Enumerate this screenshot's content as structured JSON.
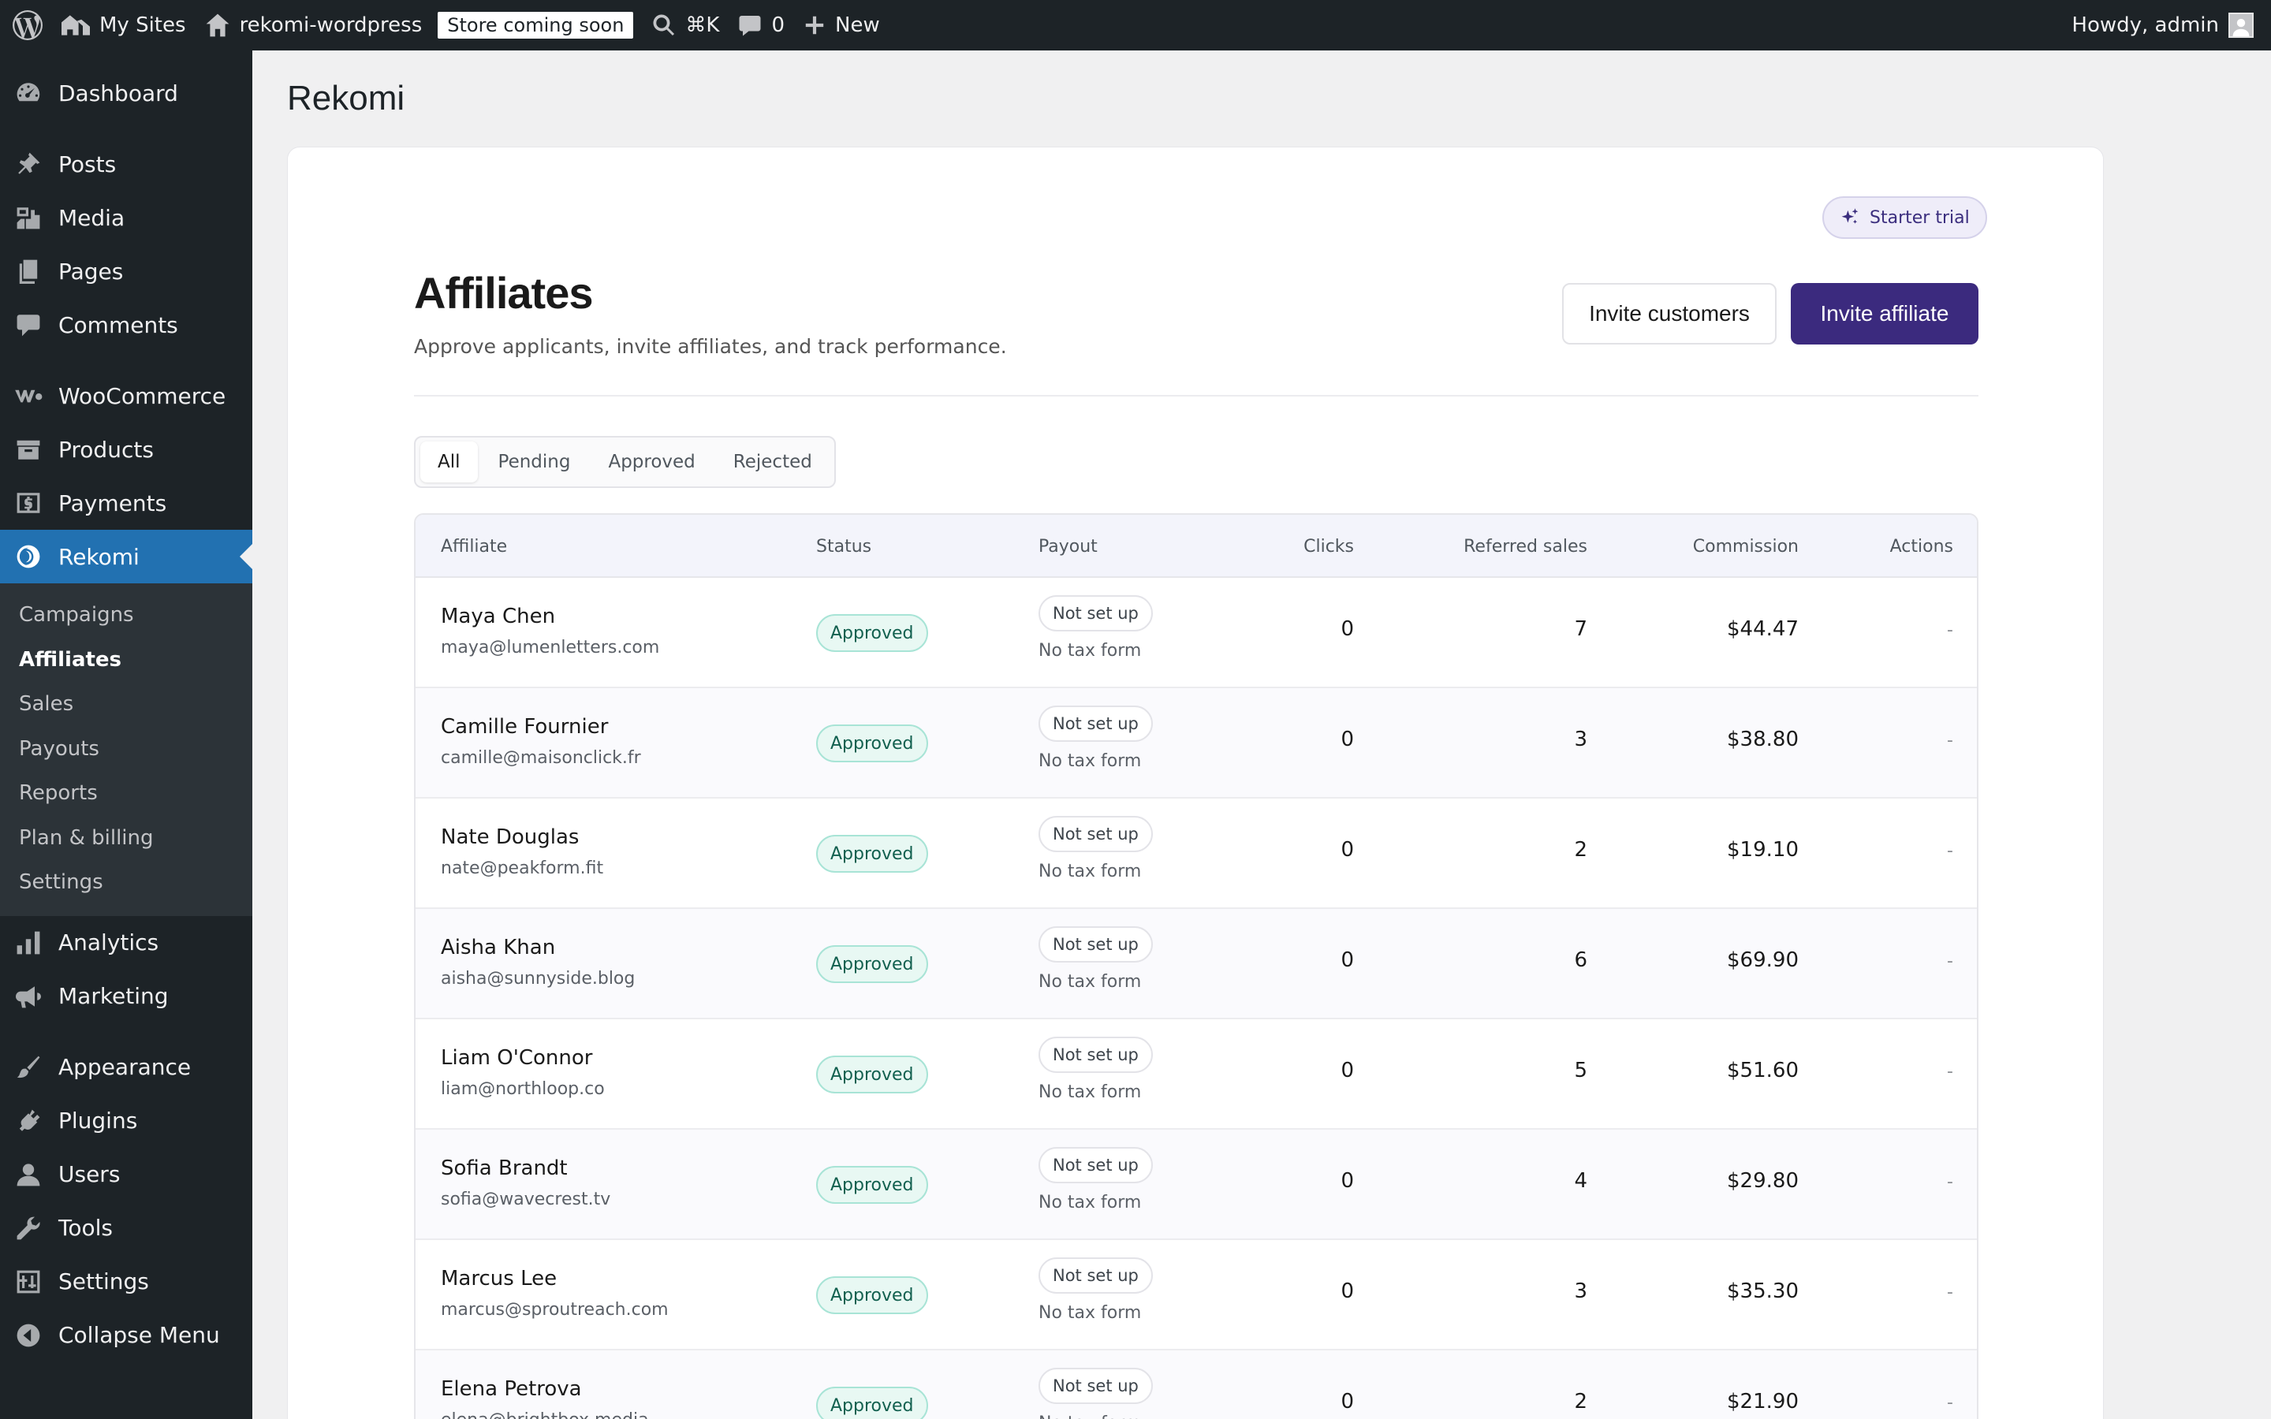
{
  "adminbar": {
    "my_sites": "My Sites",
    "site_name": "rekomi-wordpress",
    "store_badge": "Store coming soon",
    "search_shortcut": "⌘K",
    "comments_count": "0",
    "new_label": "New",
    "howdy": "Howdy, admin"
  },
  "sidebar": {
    "items": [
      {
        "label": "Dashboard",
        "icon": "dashboard-icon"
      },
      {
        "label": "Posts",
        "icon": "pin-icon"
      },
      {
        "label": "Media",
        "icon": "media-icon"
      },
      {
        "label": "Pages",
        "icon": "pages-icon"
      },
      {
        "label": "Comments",
        "icon": "comments-icon"
      },
      {
        "label": "WooCommerce",
        "icon": "woocommerce-icon"
      },
      {
        "label": "Products",
        "icon": "archive-icon"
      },
      {
        "label": "Payments",
        "icon": "dollar-icon"
      },
      {
        "label": "Rekomi",
        "icon": "rekomi-icon"
      },
      {
        "label": "Analytics",
        "icon": "bar-chart-icon"
      },
      {
        "label": "Marketing",
        "icon": "megaphone-icon"
      },
      {
        "label": "Appearance",
        "icon": "brush-icon"
      },
      {
        "label": "Plugins",
        "icon": "plug-icon"
      },
      {
        "label": "Users",
        "icon": "user-icon"
      },
      {
        "label": "Tools",
        "icon": "wrench-icon"
      },
      {
        "label": "Settings",
        "icon": "settings-icon"
      },
      {
        "label": "Collapse Menu",
        "icon": "collapse-icon"
      }
    ],
    "submenu": [
      "Campaigns",
      "Affiliates",
      "Sales",
      "Payouts",
      "Reports",
      "Plan & billing",
      "Settings"
    ]
  },
  "page": {
    "heading": "Rekomi",
    "trial_label": "Starter trial",
    "title": "Affiliates",
    "subtitle": "Approve applicants, invite affiliates, and track performance.",
    "invite_customers": "Invite customers",
    "invite_affiliate": "Invite affiliate"
  },
  "filters": [
    "All",
    "Pending",
    "Approved",
    "Rejected"
  ],
  "table": {
    "headers": [
      "Affiliate",
      "Status",
      "Payout",
      "Clicks",
      "Referred sales",
      "Commission",
      "Actions"
    ],
    "rows": [
      {
        "name": "Maya Chen",
        "email": "maya@lumenletters.com",
        "status": "Approved",
        "payout": "Not set up",
        "tax": "No tax form",
        "clicks": "0",
        "sales": "7",
        "commission": "$44.47",
        "actions": "-"
      },
      {
        "name": "Camille Fournier",
        "email": "camille@maisonclick.fr",
        "status": "Approved",
        "payout": "Not set up",
        "tax": "No tax form",
        "clicks": "0",
        "sales": "3",
        "commission": "$38.80",
        "actions": "-"
      },
      {
        "name": "Nate Douglas",
        "email": "nate@peakform.fit",
        "status": "Approved",
        "payout": "Not set up",
        "tax": "No tax form",
        "clicks": "0",
        "sales": "2",
        "commission": "$19.10",
        "actions": "-"
      },
      {
        "name": "Aisha Khan",
        "email": "aisha@sunnyside.blog",
        "status": "Approved",
        "payout": "Not set up",
        "tax": "No tax form",
        "clicks": "0",
        "sales": "6",
        "commission": "$69.90",
        "actions": "-"
      },
      {
        "name": "Liam O'Connor",
        "email": "liam@northloop.co",
        "status": "Approved",
        "payout": "Not set up",
        "tax": "No tax form",
        "clicks": "0",
        "sales": "5",
        "commission": "$51.60",
        "actions": "-"
      },
      {
        "name": "Sofia Brandt",
        "email": "sofia@wavecrest.tv",
        "status": "Approved",
        "payout": "Not set up",
        "tax": "No tax form",
        "clicks": "0",
        "sales": "4",
        "commission": "$29.80",
        "actions": "-"
      },
      {
        "name": "Marcus Lee",
        "email": "marcus@sproutreach.com",
        "status": "Approved",
        "payout": "Not set up",
        "tax": "No tax form",
        "clicks": "0",
        "sales": "3",
        "commission": "$35.30",
        "actions": "-"
      },
      {
        "name": "Elena Petrova",
        "email": "elena@brightbox.media",
        "status": "Approved",
        "payout": "Not set up",
        "tax": "No tax form",
        "clicks": "0",
        "sales": "2",
        "commission": "$21.90",
        "actions": "-"
      }
    ]
  },
  "colors": {
    "accent": "#3b2a7e",
    "wp_blue": "#2271b1",
    "approved_bg": "#e8f8f3"
  }
}
